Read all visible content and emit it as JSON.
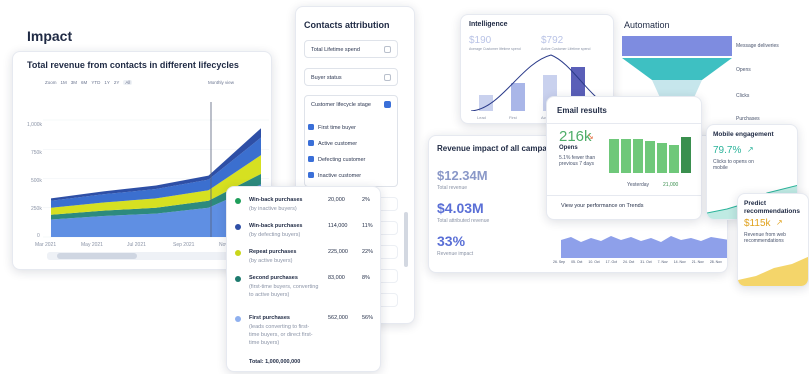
{
  "impact": {
    "heading": "Impact",
    "chart_title": "Total revenue from contacts in different lifecycles",
    "ranges": [
      "Zoom",
      "1M",
      "3M",
      "6M",
      "YTD",
      "1Y",
      "2Y",
      "All"
    ],
    "view_label": "Monthly view",
    "y_ticks": [
      "1,000k",
      "750k",
      "500k",
      "250k",
      "0"
    ],
    "x_ticks": [
      "Mar 2021",
      "May 2021",
      "Jul 2021",
      "Sep 2021",
      "Nov 2021"
    ]
  },
  "chart_data": {
    "type": "area",
    "title": "Total revenue from contacts in different lifecycles",
    "categories": [
      "Mar 2021",
      "May 2021",
      "Jul 2021",
      "Sep 2021",
      "Nov 2021"
    ],
    "ylim": [
      0,
      1000
    ],
    "series": [
      {
        "name": "First purchases",
        "color": "#5f8fe3",
        "values": [
          150,
          180,
          200,
          250,
          450
        ]
      },
      {
        "name": "Second purchases",
        "color": "#2d8a7e",
        "values": [
          40,
          45,
          50,
          60,
          90
        ]
      },
      {
        "name": "Repeat purchases",
        "color": "#d6e021",
        "values": [
          60,
          70,
          80,
          90,
          160
        ]
      },
      {
        "name": "Win-back purchases (by defecting buyers)",
        "color": "#3b6fcf",
        "values": [
          60,
          70,
          80,
          90,
          150
        ]
      },
      {
        "name": "Win-back purchases (by inactive buyers)",
        "color": "#2e4fa6",
        "values": [
          20,
          25,
          30,
          35,
          80
        ]
      }
    ]
  },
  "attribution": {
    "title": "Contacts attribution",
    "rows": [
      "Total Lifetime spend",
      "Buyer status",
      "Customer lifecycle stage"
    ],
    "checks": [
      "First time buyer",
      "Active customer",
      "Defecting customer",
      "Inactive customer"
    ]
  },
  "tooltip": {
    "items": [
      {
        "label": "Win-back purchases",
        "sub": "(by inactive buyers)",
        "value": "20,000",
        "pct": "2%",
        "color": "#1e9e5a"
      },
      {
        "label": "Win-back purchases",
        "sub": "(by defecting buyers)",
        "value": "114,000",
        "pct": "11%",
        "color": "#2e4fa6"
      },
      {
        "label": "Repeat purchases",
        "sub": "(by active buyers)",
        "value": "225,000",
        "pct": "22%",
        "color": "#c9d61a"
      },
      {
        "label": "Second purchases",
        "sub": "(first-time buyers, converting to active buyers)",
        "value": "83,000",
        "pct": "8%",
        "color": "#1d7a6e"
      },
      {
        "label": "First purchases",
        "sub": "(leads converting to first-time buyers, or direct first-time buyers)",
        "value": "562,000",
        "pct": "56%",
        "color": "#8fb0ef"
      }
    ],
    "total": "Total: 1,000,000,000"
  },
  "intelligence": {
    "title": "Intelligence",
    "m1": "$190",
    "m1_label": "Average Customer lifetime spend",
    "m2": "$792",
    "m2_label": "Active Customer Lifetime spend",
    "bars": [
      "Lead",
      "First",
      "Active"
    ]
  },
  "automation": {
    "title": "Automation",
    "steps": [
      "Message deliveries",
      "Opens",
      "Clicks",
      "Purchases"
    ]
  },
  "revenue_impact": {
    "title": "Revenue impact of all campaigns",
    "total_revenue": "$12.34M",
    "total_revenue_label": "Total revenue",
    "attributed": "$4.03M",
    "attributed_label": "Total attributed revenue",
    "impact": "33%",
    "impact_label": "Revenue impact",
    "x_ticks": [
      "26. Sep",
      "05. Oct",
      "10. Oct",
      "17. Oct",
      "24. Oct",
      "31. Oct",
      "7. Nov",
      "14. Nov",
      "21. Nov",
      "28. Nov"
    ]
  },
  "email_results": {
    "title": "Email results",
    "value": "216k",
    "label": "Opens",
    "desc": "5.1% fewer than previous 7 days",
    "yesterday_label": "Yesterday",
    "yesterday_value": "21,000",
    "link": "View your performance on Trends"
  },
  "mobile": {
    "title": "Mobile engagement",
    "value": "79.7%",
    "desc": "Clicks to opens on mobile"
  },
  "predict": {
    "title": "Predict recommendations",
    "value": "$115k",
    "desc": "Revenue from web recommendations"
  }
}
